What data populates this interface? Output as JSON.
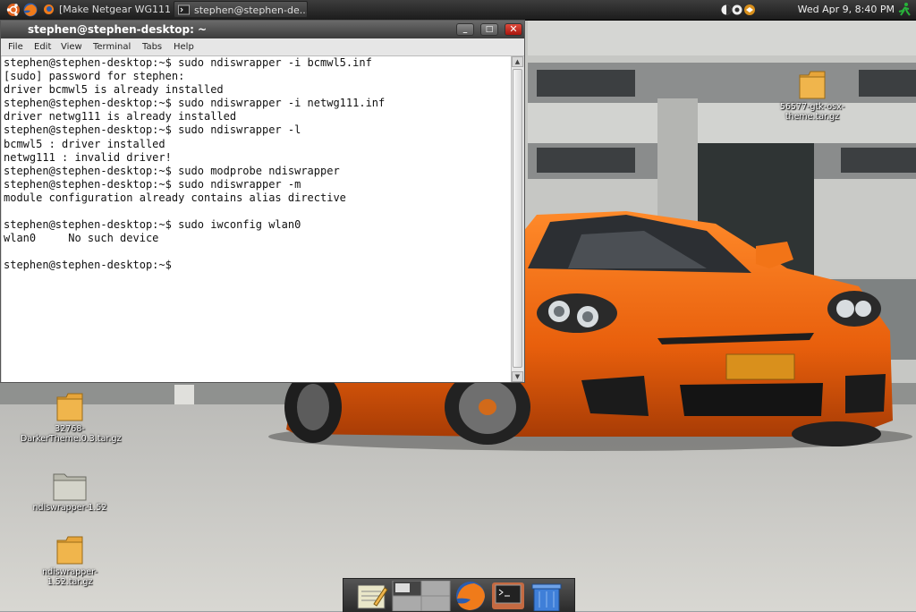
{
  "top_panel": {
    "tasks": [
      {
        "label": "[Make Netgear WG111..."
      },
      {
        "label": "stephen@stephen-de..."
      }
    ],
    "clock": "Wed Apr  9,  8:40 PM"
  },
  "terminal": {
    "title": "stephen@stephen-desktop: ~",
    "menu": [
      "File",
      "Edit",
      "View",
      "Terminal",
      "Tabs",
      "Help"
    ],
    "lines": [
      "stephen@stephen-desktop:~$ sudo ndiswrapper -i bcmwl5.inf",
      "[sudo] password for stephen:",
      "driver bcmwl5 is already installed",
      "stephen@stephen-desktop:~$ sudo ndiswrapper -i netwg111.inf",
      "driver netwg111 is already installed",
      "stephen@stephen-desktop:~$ sudo ndiswrapper -l",
      "bcmwl5 : driver installed",
      "netwg111 : invalid driver!",
      "stephen@stephen-desktop:~$ sudo modprobe ndiswrapper",
      "stephen@stephen-desktop:~$ sudo ndiswrapper -m",
      "module configuration already contains alias directive",
      "",
      "stephen@stephen-desktop:~$ sudo iwconfig wlan0",
      "wlan0     No such device",
      "",
      "stephen@stephen-desktop:~$"
    ]
  },
  "desktop_icons": {
    "gtk_theme": "56577-gtk-osx-theme.tar.gz",
    "darker_theme": "32768-DarkerTheme.0.3.tar.gz",
    "ndis_folder": "ndiswrapper-1.52",
    "ndis_archive": "ndiswrapper-1.52.tar.gz"
  },
  "dock": {
    "items": [
      "text-editor-icon",
      "workspace-switcher-icon",
      "firefox-icon",
      "terminal-icon",
      "trash-icon"
    ]
  },
  "colors": {
    "car": "#f06a12",
    "terminal_bg": "#ffffff",
    "close_button": "#c8241a"
  }
}
